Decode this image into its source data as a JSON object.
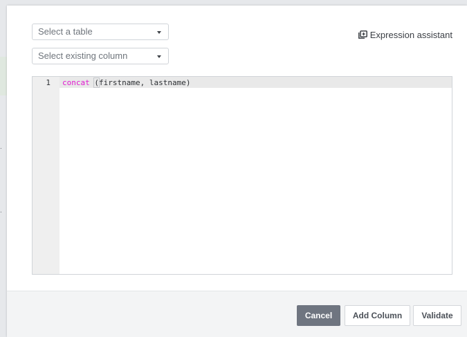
{
  "background": {
    "marks": [
      ".",
      "."
    ]
  },
  "selects": {
    "table": {
      "value": "Select a table"
    },
    "column": {
      "value": "Select existing column"
    }
  },
  "assistant": {
    "label": "Expression assistant",
    "icon": "expression-assistant-icon"
  },
  "editor": {
    "line_number": "1",
    "code": {
      "function": "concat",
      "space": " ",
      "open_paren": "(",
      "args": "firstname, lastname",
      "close_paren": ")"
    },
    "keyword_color": "#e11ad0"
  },
  "footer": {
    "cancel_label": "Cancel",
    "add_label": "Add Column",
    "validate_label": "Validate"
  },
  "colors": {
    "cancel_bg": "#6f7580",
    "dialog_bg": "#ffffff",
    "footer_bg": "#f3f4f5"
  }
}
